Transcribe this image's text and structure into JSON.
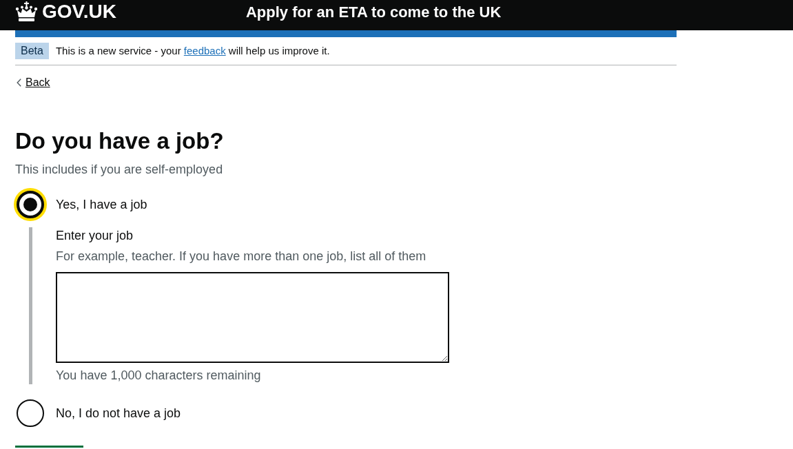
{
  "header": {
    "logo_text": "GOV.UK",
    "service_name": "Apply for an ETA to come to the UK"
  },
  "phase_banner": {
    "tag": "Beta",
    "text_before": "This is a new service - your ",
    "link": "feedback",
    "text_after": " will help us improve it."
  },
  "back_link": "Back",
  "question": {
    "heading": "Do you have a job?",
    "hint": "This includes if you are self-employed",
    "options": [
      {
        "label": "Yes, I have a job",
        "selected": true,
        "focused": true,
        "conditional": {
          "label": "Enter your job",
          "hint": "For example, teacher. If you have more than one job, list all of them",
          "count_message": "You have 1,000 characters remaining"
        }
      },
      {
        "label": "No, I do not have a job",
        "selected": false,
        "focused": false
      }
    ]
  }
}
